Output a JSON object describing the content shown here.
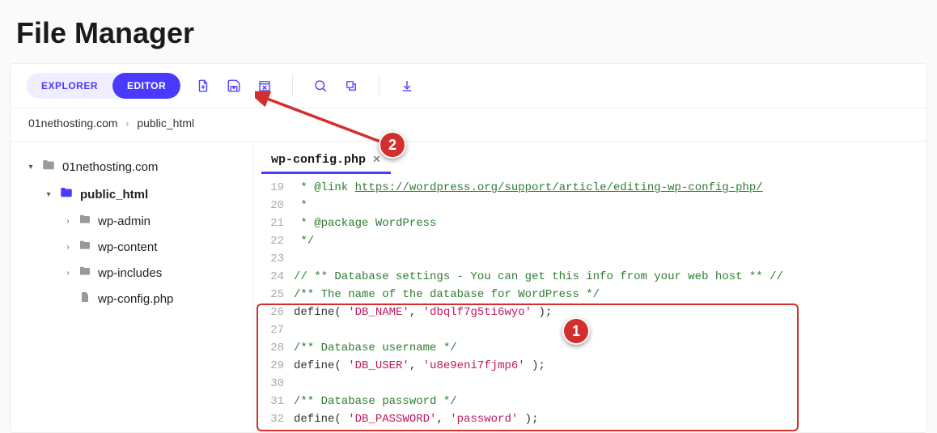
{
  "page_title": "File Manager",
  "toggle": {
    "explorer_label": "EXPLORER",
    "editor_label": "EDITOR"
  },
  "breadcrumb": {
    "root": "01nethosting.com",
    "path": "public_html"
  },
  "tree": {
    "root": "01nethosting.com",
    "folder": "public_html",
    "children": [
      "wp-admin",
      "wp-content",
      "wp-includes"
    ],
    "file": "wp-config.php"
  },
  "tab_filename": "wp-config.php",
  "code_start_line": 19,
  "code_lines": [
    {
      "n": 19,
      "parts": [
        {
          "t": " * @link ",
          "c": "cmt"
        },
        {
          "t": "https://wordpress.org/support/article/editing-wp-config-php/",
          "c": "link"
        }
      ]
    },
    {
      "n": 20,
      "parts": [
        {
          "t": " *",
          "c": "cmt"
        }
      ]
    },
    {
      "n": 21,
      "parts": [
        {
          "t": " * @package WordPress",
          "c": "cmt"
        }
      ]
    },
    {
      "n": 22,
      "parts": [
        {
          "t": " */",
          "c": "cmt"
        }
      ]
    },
    {
      "n": 23,
      "parts": [
        {
          "t": " ",
          "c": "fn"
        }
      ]
    },
    {
      "n": 24,
      "parts": [
        {
          "t": "// ** Database settings - You can get this info from your web host ** //",
          "c": "cmt"
        }
      ]
    },
    {
      "n": 25,
      "parts": [
        {
          "t": "/** The name of the database for WordPress */",
          "c": "cmt"
        }
      ]
    },
    {
      "n": 26,
      "parts": [
        {
          "t": "define( ",
          "c": "fn"
        },
        {
          "t": "'DB_NAME'",
          "c": "str"
        },
        {
          "t": ", ",
          "c": "fn"
        },
        {
          "t": "'dbqlf7g5ti6wyo'",
          "c": "str"
        },
        {
          "t": " );",
          "c": "fn"
        }
      ]
    },
    {
      "n": 27,
      "parts": [
        {
          "t": " ",
          "c": "fn"
        }
      ]
    },
    {
      "n": 28,
      "parts": [
        {
          "t": "/** Database username */",
          "c": "cmt"
        }
      ]
    },
    {
      "n": 29,
      "parts": [
        {
          "t": "define( ",
          "c": "fn"
        },
        {
          "t": "'DB_USER'",
          "c": "str"
        },
        {
          "t": ", ",
          "c": "fn"
        },
        {
          "t": "'u8e9eni7fjmp6'",
          "c": "str"
        },
        {
          "t": " );",
          "c": "fn"
        }
      ]
    },
    {
      "n": 30,
      "parts": [
        {
          "t": " ",
          "c": "fn"
        }
      ]
    },
    {
      "n": 31,
      "parts": [
        {
          "t": "/** Database password */",
          "c": "cmt"
        }
      ]
    },
    {
      "n": 32,
      "parts": [
        {
          "t": "define( ",
          "c": "fn"
        },
        {
          "t": "'DB_PASSWORD'",
          "c": "str"
        },
        {
          "t": ", ",
          "c": "fn"
        },
        {
          "t": "'password'",
          "c": "str"
        },
        {
          "t": " );",
          "c": "fn"
        }
      ]
    }
  ],
  "annotations": {
    "one": "1",
    "two": "2"
  }
}
